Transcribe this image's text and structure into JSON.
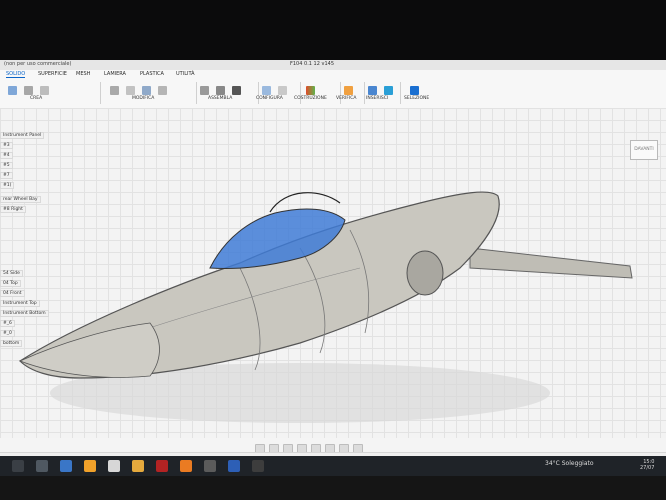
{
  "window": {
    "app_title": "(non per uso commerciale)",
    "doc_title": "F104 0.1 12 v145"
  },
  "ribbon": {
    "tabs": [
      "SOLIDO",
      "SUPERFICIE",
      "MESH",
      "LAMIERA",
      "PLASTICA",
      "UTILITÀ"
    ],
    "groups": [
      {
        "label": "CREA",
        "icon": "create-icon"
      },
      {
        "label": "MODIFICA",
        "icon": "modify-icon"
      },
      {
        "label": "ASSEMBLA",
        "icon": "assemble-icon"
      },
      {
        "label": "CONFIGURA",
        "icon": "configure-icon"
      },
      {
        "label": "COSTRUZIONE",
        "icon": "construction-icon"
      },
      {
        "label": "VERIFICA",
        "icon": "inspect-icon"
      },
      {
        "label": "INSERISCI",
        "icon": "insert-icon"
      },
      {
        "label": "SELEZIONE",
        "icon": "select-icon"
      }
    ]
  },
  "browser": {
    "items": [
      "Instrument Panel",
      "#3",
      "#4",
      "#5",
      "#7",
      "#1)",
      "rear Wheel Bay",
      "#8 Right",
      "54 Side",
      "04 Top",
      "04 Front",
      "Instrument Top",
      "Instrument Bottom",
      "#_6",
      "#_0",
      "bottom"
    ]
  },
  "viewcube": {
    "label": "DAVANTI"
  },
  "status": {
    "weather": "34°C Soleggiato",
    "time": "15:0",
    "date": "27/07"
  },
  "colors": {
    "accent": "#0a64c8",
    "fuselage": "#c7c5bd",
    "cockpit": "#3f7bd6"
  }
}
